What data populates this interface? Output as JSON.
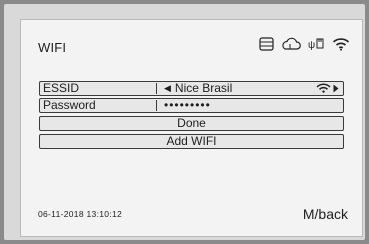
{
  "screen": {
    "title": "WIFI"
  },
  "status_icons": [
    "storage-icon",
    "cloud-icon",
    "usb-icon",
    "wifi-icon"
  ],
  "form": {
    "essid_label": "ESSID",
    "essid_value": "Nice Brasil",
    "password_label": "Password",
    "password_value": "•••••••••",
    "done_label": "Done",
    "add_wifi_label": "Add WIFI"
  },
  "footer": {
    "datetime": "06-11-2018  13:10:12",
    "back_label": "M/back"
  }
}
